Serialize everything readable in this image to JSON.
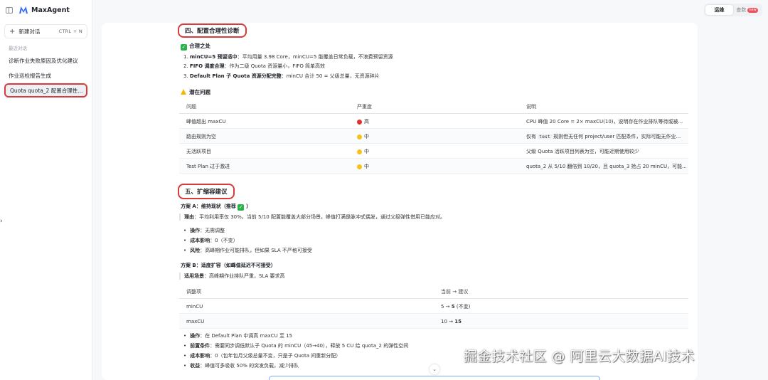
{
  "app": {
    "name": "MaxAgent"
  },
  "sidebar": {
    "new_chat_label": "新建对话",
    "new_chat_shortcut": "CTRL + N",
    "recent_label": "最近对话",
    "items": [
      {
        "label": "诊断作业失败原因及优化建议"
      },
      {
        "label": "作业巡检报告生成"
      },
      {
        "label": "Quota quota_2 配置合理性..."
      }
    ]
  },
  "mode": {
    "tabs": [
      "运维",
      "查数"
    ],
    "new_badge": "new",
    "active": "运维"
  },
  "section4": {
    "title": "四、配置合理性诊断",
    "ok_heading": "合理之处",
    "ok_items": [
      {
        "num": "1.",
        "bold": "minCU=5 预留适中",
        "rest": "：平均用量 3.98 Core，minCU=5 能覆盖日常负载，不浪费预留资源"
      },
      {
        "num": "2.",
        "bold": "FIFO 调度合理",
        "rest": "：作为二级 Quota 资源量小，FIFO 简单高效"
      },
      {
        "num": "3.",
        "bold": "Default Plan 子 Quota 资源分配完整",
        "rest": "：minCU 合计 50 = 父级总量，无资源碎片"
      }
    ],
    "issue_heading": "潜在问题",
    "table": {
      "headers": [
        "问题",
        "严重度",
        "说明"
      ],
      "rows": [
        {
          "problem": "峰值超出 maxCU",
          "severity": "高",
          "severity_color": "#e0312e",
          "desc": "CPU 峰值 20 Core = 2× maxCU(10)，说明存在作业排队等待或被..."
        },
        {
          "problem": "路由规则为空",
          "severity": "中",
          "severity_color": "#f5c21b",
          "desc_pre": "仅有",
          "desc_code": "test",
          "desc": "规则但无任何 project/user 匹配条件，实际可能无作业..."
        },
        {
          "problem": "无活跃项目",
          "severity": "中",
          "severity_color": "#f5c21b",
          "desc": "父级 Quota 活跃项目列表为空，可能近期使用较少"
        },
        {
          "problem": "Test Plan 过于激进",
          "severity": "中",
          "severity_color": "#f5c21b",
          "desc": "quota_2 从 5/10 翻倍到 10/20，且 quota_3 抢占 20 minCU，可能..."
        }
      ]
    }
  },
  "section5": {
    "title": "五、扩缩容建议",
    "planA": {
      "heading": "方案 A：维持现状（推荐",
      "reason_bold": "理由",
      "reason": "：平均利用率仅 30%，当前 5/10 配置能覆盖大部分场景，峰值打满是脉冲式偶发，通过父级弹性借用已能应对。",
      "bullets": [
        {
          "bold": "操作",
          "rest": "：无需调整"
        },
        {
          "bold": "成本影响",
          "rest": "：0（不变）"
        },
        {
          "bold": "风险",
          "rest": "：高峰期作业可能排队，但如果 SLA 不严格可接受"
        }
      ]
    },
    "planB": {
      "heading": "方案 B：适度扩容（如峰值延迟不可接受）",
      "scene_bold": "适用场景",
      "scene": "：高峰期作业排队严重，SLA 要求高",
      "table": {
        "headers": [
          "调整项",
          "当前 → 建议"
        ],
        "rows": [
          {
            "item": "minCU",
            "from": "5 →",
            "to": "5",
            "note": "(不变)"
          },
          {
            "item": "maxCU",
            "from": "10 →",
            "to": "15",
            "note": ""
          }
        ]
      },
      "bullets": [
        {
          "bold": "操作",
          "rest": "：在 Default Plan 中调高 maxCU 至 15"
        },
        {
          "bold": "前置条件",
          "rest": "：需要同步调低默认子 Quota 的 minCU（45→40），释放 5 CU 给 quota_2 的弹性空间"
        },
        {
          "bold": "成本影响",
          "rest": "：0（包年包月父级总量不变，只是子 Quota 间重新分配）"
        },
        {
          "bold": "收益",
          "rest": "：峰值可多吸收 50% 的突发负载，减少排队"
        }
      ]
    }
  },
  "watermark": "掘金技术社区 @ 阿里云大数据AI技术"
}
